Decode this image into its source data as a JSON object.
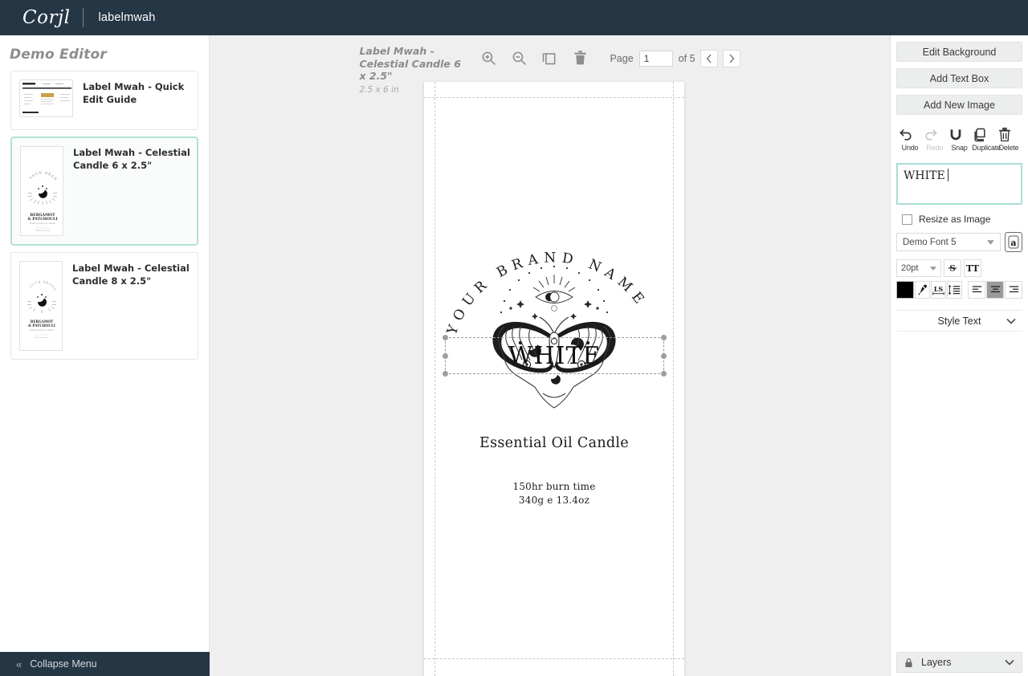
{
  "topbar": {
    "logo_text": "Corjl",
    "account_name": "labelmwah",
    "logo_icon": "corjl-wordmark"
  },
  "sidebar": {
    "title": "Demo Editor",
    "collapse_label": "Collapse Menu",
    "collapse_icon": "chevron-double-left-icon",
    "documents": [
      {
        "label": "Label Mwah - Quick Edit Guide",
        "thumb_type": "wide",
        "selected": false
      },
      {
        "label": "Label Mwah - Celestial Candle 6 x 2.5\"",
        "thumb_type": "tall",
        "selected": true
      },
      {
        "label": "Label Mwah - Celestial Candle 8 x 2.5\"",
        "thumb_type": "tall",
        "selected": false
      }
    ]
  },
  "canvas_toolbar": {
    "doc_title": "Label Mwah - Celestial Candle 6 x 2.5\"",
    "doc_dimensions": "2.5 x 6 in",
    "zoom_in_icon": "zoom-in-icon",
    "zoom_out_icon": "zoom-out-icon",
    "copy_icon": "duplicate-page-icon",
    "trash_icon": "trash-icon",
    "page_label": "Page",
    "page_value": "1",
    "page_of": "of 5",
    "prev_icon": "chevron-left-icon",
    "next_icon": "chevron-right-icon"
  },
  "canvas": {
    "brand_arc_text": "YOUR BRAND NAME",
    "artwork_icon": "celestial-moth-hands-illustration",
    "selected_text": "WHITE",
    "subtitle": "Essential Oil Candle",
    "detail_line_1": "150hr burn time",
    "detail_line_2": "340g e 13.4oz"
  },
  "right_panel": {
    "edit_background_label": "Edit Background",
    "add_text_box_label": "Add Text Box",
    "add_new_image_label": "Add New Image",
    "tools": [
      {
        "label": "Undo",
        "icon": "undo-icon",
        "disabled": false
      },
      {
        "label": "Redo",
        "icon": "redo-icon",
        "disabled": true
      },
      {
        "label": "Snap",
        "icon": "magnet-snap-icon",
        "disabled": false
      },
      {
        "label": "Duplicate",
        "icon": "duplicate-icon",
        "disabled": false
      },
      {
        "label": "Delete",
        "icon": "trash-icon",
        "disabled": false
      }
    ],
    "text_value": "WHITE",
    "resize_as_image_label": "Resize as Image",
    "resize_as_image_checked": false,
    "font_family_value": "Demo Font 5",
    "font_picker_icon": "font-glyph-icon",
    "font_size_value": "20pt",
    "strikethrough_icon": "strikethrough-icon",
    "uppercase_icon": "text-transform-icon",
    "uppercase_label": "TT",
    "color_swatch": "#000000",
    "eyedropper_icon": "eyedropper-icon",
    "letter_spacing_icon": "letter-spacing-icon",
    "letter_spacing_label": "LS",
    "line_height_icon": "line-height-icon",
    "align_left_icon": "align-left-icon",
    "align_center_icon": "align-center-icon",
    "align_right_icon": "align-right-icon",
    "align_active": "center",
    "style_text_label": "Style Text",
    "style_text_chevron": "chevron-down-icon",
    "layers_label": "Layers",
    "layers_lock_icon": "lock-icon",
    "layers_chevron": "chevron-down-icon"
  },
  "colors": {
    "topbar_bg": "#253645",
    "accent_selected_border": "#b6e0d8",
    "canvas_bg": "#efefef",
    "panel_button_bg": "#eceded"
  }
}
